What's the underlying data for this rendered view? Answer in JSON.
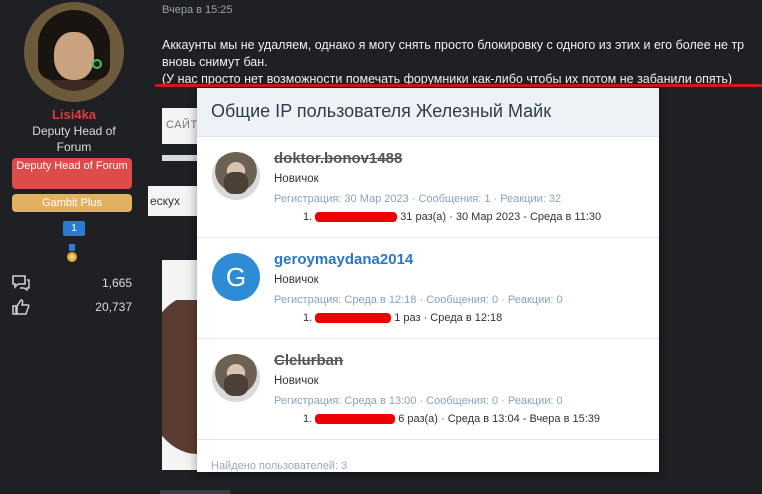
{
  "user": {
    "username": "Lisi4ka",
    "title": "Deputy Head of Forum",
    "banner_red": "Deputy Head of Forum",
    "banner_gold": "Gambit Plus",
    "badge_count": "1",
    "messages": "1,665",
    "reactions": "20,737"
  },
  "post": {
    "time": "Вчера в 15:25",
    "line1": "Аккаунты мы не удаляем, однако я могу снять просто блокировку с одного из этих и его более не тр",
    "line2": "вновь снимут бан.",
    "line3": "(У нас просто нет возможности помечать форумники как-либо чтобы их потом не забанили опять)"
  },
  "background": {
    "frag1": "САЙТ",
    "frag3": "ескух"
  },
  "modal": {
    "title": "Общие IP пользователя Железный Майк",
    "users": [
      {
        "name": "doktor.bonov1488",
        "banned": true,
        "rank": "Новичок",
        "reg_label": "Регистрация:",
        "reg": "30 Мар 2023",
        "msg_label": "Сообщения:",
        "msg": "1",
        "react_label": "Реакции:",
        "react": "32",
        "ip_index": "1.",
        "ip_tail": "31 раз(а) · 30 Мар 2023 - Среда в 11:30"
      },
      {
        "name": "geroymaydana2014",
        "banned": false,
        "avatar_letter": "G",
        "rank": "Новичок",
        "reg_label": "Регистрация:",
        "reg": "Среда в 12:18",
        "msg_label": "Сообщения:",
        "msg": "0",
        "react_label": "Реакции:",
        "react": "0",
        "ip_index": "1.",
        "ip_tail": "1 раз · Среда в 12:18"
      },
      {
        "name": "Clelurban",
        "banned": true,
        "rank": "Новичок",
        "reg_label": "Регистрация:",
        "reg": "Среда в 13:00",
        "msg_label": "Сообщения:",
        "msg": "0",
        "react_label": "Реакции:",
        "react": "0",
        "ip_index": "1.",
        "ip_tail": "6 раз(а) · Среда в 13:04 - Вчера в 15:39"
      }
    ],
    "found": "Найдено пользователей: 3"
  },
  "colors": {
    "username": "#e03a3a",
    "banner_red": "#dd4b4b",
    "banner_gold": "#e2b160",
    "link_blue": "#2a77c4",
    "redaction": "#e00000"
  }
}
